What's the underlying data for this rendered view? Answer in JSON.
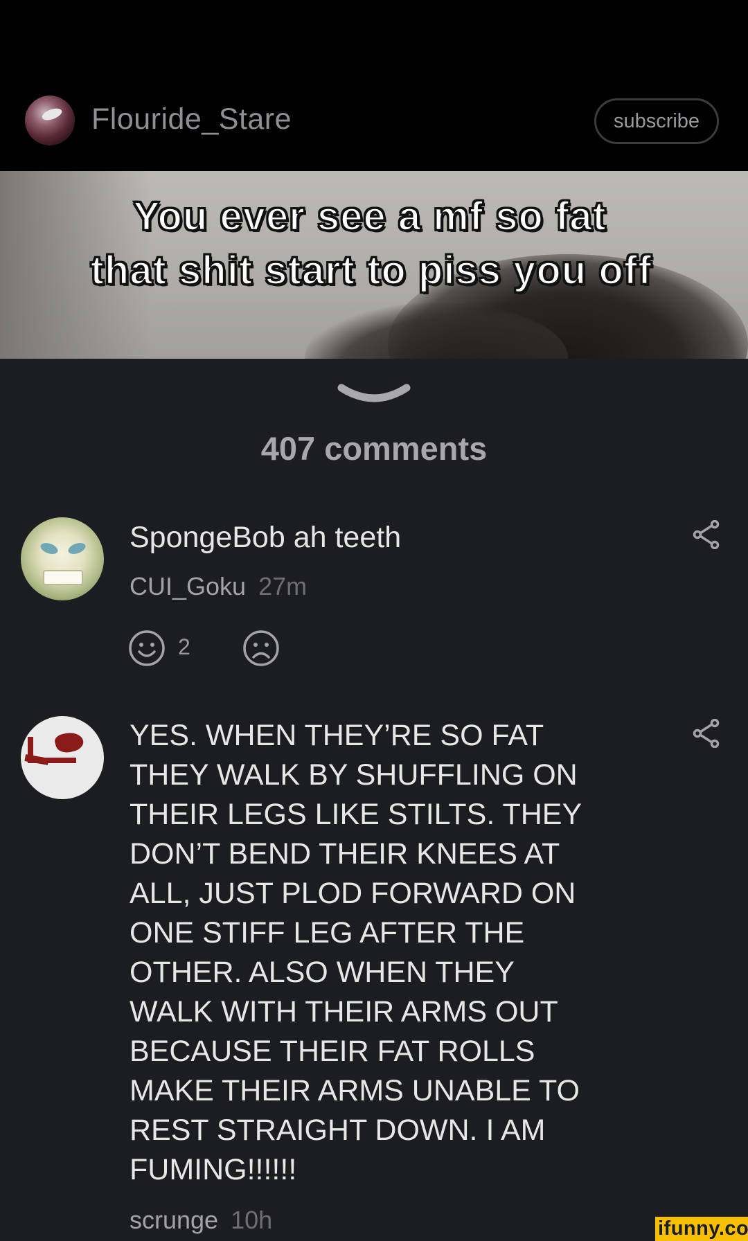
{
  "header": {
    "channel_name": "Flouride_Stare",
    "subscribe_label": "subscribe"
  },
  "meme": {
    "caption_line1": "You ever see a mf so fat",
    "caption_line2": "that shit start to piss you off"
  },
  "comments_count_label": "407 comments",
  "comments": [
    {
      "text": "SpongeBob ah teeth",
      "username": "CUI_Goku",
      "time": "27m",
      "smile_count": "2",
      "avatar_icon": "skull-avatar-icon"
    },
    {
      "text_lines": [
        "YES. WHEN THEY’RE SO FAT",
        "THEY WALK BY SHUFFLING ON",
        "THEIR LEGS LIKE STILTS. THEY",
        "DON’T BEND THEIR KNEES AT",
        "ALL, JUST PLOD FORWARD ON",
        "ONE STIFF LEG AFTER THE",
        "OTHER. ALSO WHEN THEY",
        "WALK WITH THEIR ARMS OUT",
        "BECAUSE THEIR FAT ROLLS",
        "MAKE THEIR ARMS UNABLE TO",
        "REST STRAIGHT DOWN. I AM",
        "FUMING!!!!!!"
      ],
      "username": "scrunge",
      "time": "10h",
      "avatar_icon": "red-drawing-avatar-icon"
    }
  ],
  "icons": {
    "share": "share-icon",
    "smile": "smile-icon",
    "frown": "frown-icon",
    "collapse": "chevron-down-icon"
  },
  "watermark": "ifunny.co",
  "colors": {
    "background": "#1c1d21",
    "header_background": "#000000",
    "watermark_bg": "#f6c000"
  }
}
